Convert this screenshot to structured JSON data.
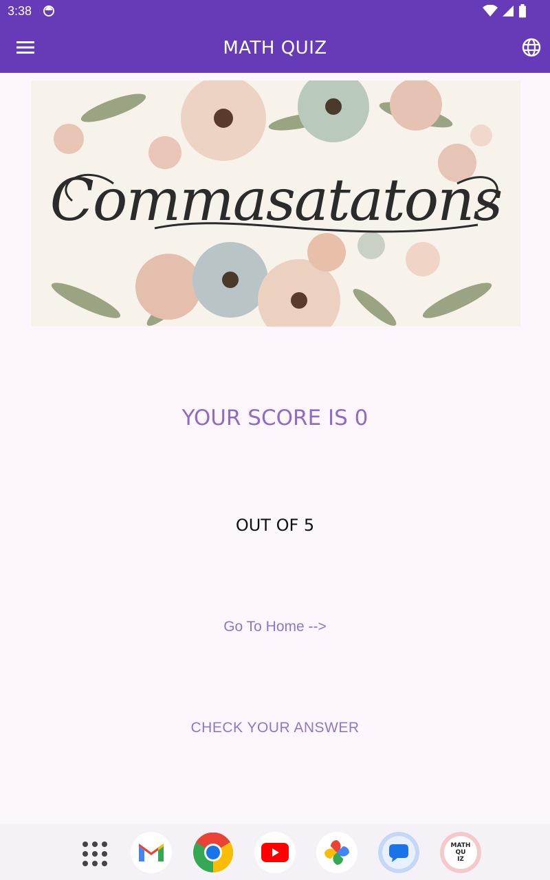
{
  "status_bar": {
    "time": "3:38"
  },
  "app_bar": {
    "title": "MATH QUIZ"
  },
  "banner": {
    "word": "Commasatatons"
  },
  "result": {
    "score_text": "YOUR SCORE IS 0",
    "out_of_text": "OUT OF 5",
    "go_home_label": "Go To Home -->",
    "check_answer_label": "CHECK YOUR ANSWER"
  },
  "dock": {
    "math_quiz_icon_text": [
      "MATH",
      "QU",
      "IZ"
    ]
  },
  "colors": {
    "primary": "#673ab7",
    "score": "#8f6ac6",
    "link": "#8e77c3",
    "background": "#fdf7fd"
  }
}
